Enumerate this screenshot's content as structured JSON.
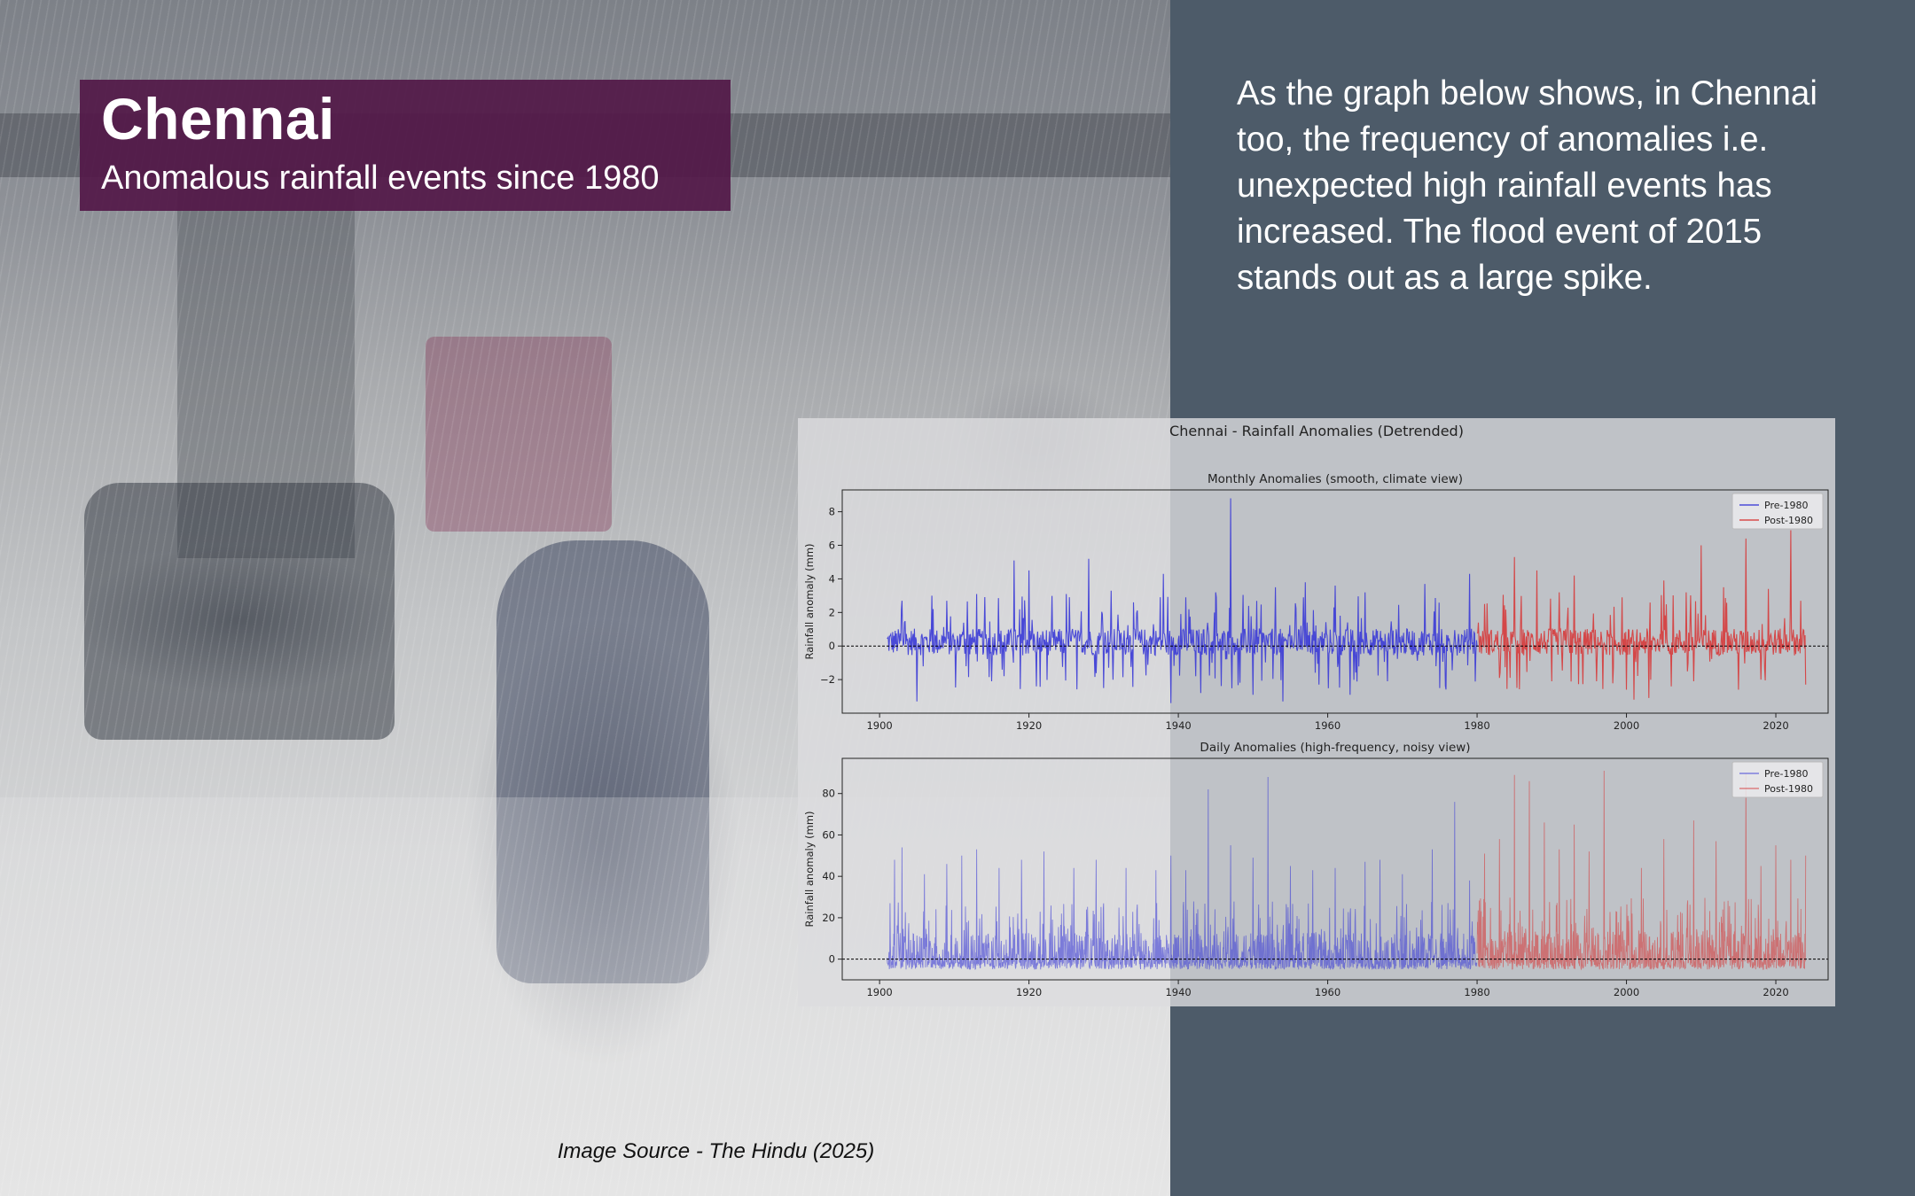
{
  "header": {
    "title": "Chennai",
    "subtitle": "Anomalous rainfall events since 1980"
  },
  "description": "As the graph below shows, in Chennai too, the frequency of anomalies i.e. unexpected high rainfall events has increased. The flood event of 2015 stands out as a large spike.",
  "source": "Image Source - The Hindu (2025)",
  "colors": {
    "background_right": "#4d5b69",
    "title_box": "#521848",
    "pre_1980": "#3a3ad6",
    "post_1980": "#d63a3a"
  },
  "chart_data": {
    "suptitle": "Chennai - Rainfall Anomalies (Detrended)",
    "panels": [
      {
        "type": "line",
        "title": "Monthly Anomalies (smooth, climate view)",
        "ylabel": "Rainfall anomaly (mm)",
        "xlim": [
          1895,
          2027
        ],
        "ylim": [
          -4,
          9.3
        ],
        "xticks": [
          1900,
          1920,
          1940,
          1960,
          1980,
          2000,
          2020
        ],
        "yticks": [
          -2,
          0,
          2,
          4,
          6,
          8
        ],
        "ytick_labels": [
          "−2",
          "0",
          "2",
          "4",
          "6",
          "8"
        ],
        "zero_line": "dashed",
        "legend_position": "top-right",
        "series": [
          {
            "name": "Pre-1980",
            "color": "#3a3ad6",
            "x_range": [
              1901,
              1980
            ],
            "peaks": [
              [
                1903,
                2.7
              ],
              [
                1905,
                2.2
              ],
              [
                1907,
                3.0
              ],
              [
                1909,
                2.7
              ],
              [
                1913,
                3.1
              ],
              [
                1915,
                4.8
              ],
              [
                1918,
                5.1
              ],
              [
                1920,
                4.5
              ],
              [
                1925,
                3.1
              ],
              [
                1928,
                5.2
              ],
              [
                1931,
                3.3
              ],
              [
                1934,
                2.6
              ],
              [
                1938,
                4.3
              ],
              [
                1941,
                2.9
              ],
              [
                1945,
                3.2
              ],
              [
                1947,
                8.8
              ],
              [
                1950,
                2.9
              ],
              [
                1953,
                3.5
              ],
              [
                1957,
                3.8
              ],
              [
                1961,
                3.6
              ],
              [
                1965,
                3.2
              ],
              [
                1968,
                2.5
              ],
              [
                1973,
                3.7
              ],
              [
                1975,
                3.9
              ],
              [
                1979,
                4.3
              ]
            ],
            "troughs": [
              [
                1905,
                -3.3
              ],
              [
                1915,
                -2.1
              ],
              [
                1921,
                -2.4
              ],
              [
                1930,
                -2.5
              ],
              [
                1939,
                -3.4
              ],
              [
                1943,
                -2.8
              ],
              [
                1950,
                -2.9
              ],
              [
                1954,
                -3.3
              ],
              [
                1963,
                -2.9
              ],
              [
                1968,
                -2.1
              ],
              [
                1975,
                -2.5
              ]
            ],
            "typical_abs": 0.8
          },
          {
            "name": "Post-1980",
            "color": "#d63a3a",
            "x_range": [
              1980,
              2024
            ],
            "peaks": [
              [
                1981,
                2.5
              ],
              [
                1985,
                5.3
              ],
              [
                1988,
                4.5
              ],
              [
                1991,
                3.2
              ],
              [
                1993,
                4.2
              ],
              [
                1996,
                5.9
              ],
              [
                2001,
                5.7
              ],
              [
                2005,
                3.9
              ],
              [
                2008,
                3.2
              ],
              [
                2010,
                6.0
              ],
              [
                2013,
                3.5
              ],
              [
                2016,
                6.4
              ],
              [
                2019,
                3.4
              ],
              [
                2022,
                6.9
              ],
              [
                2024,
                1.9
              ]
            ],
            "troughs": [
              [
                1983,
                -1.9
              ],
              [
                1990,
                -2.1
              ],
              [
                1996,
                -2.1
              ],
              [
                2000,
                -2.6
              ],
              [
                2001,
                -3.2
              ],
              [
                2003,
                -3.1
              ],
              [
                2006,
                -2.4
              ],
              [
                2009,
                -2.1
              ],
              [
                2015,
                -2.6
              ],
              [
                2018,
                -2.0
              ],
              [
                2024,
                -2.3
              ]
            ],
            "typical_abs": 0.8
          }
        ]
      },
      {
        "type": "line",
        "title": "Daily Anomalies (high-frequency, noisy view)",
        "ylabel": "Rainfall anomaly (mm)",
        "xlim": [
          1895,
          2027
        ],
        "ylim": [
          -10,
          97
        ],
        "xticks": [
          1900,
          1920,
          1940,
          1960,
          1980,
          2000,
          2020
        ],
        "yticks": [
          0,
          20,
          40,
          60,
          80
        ],
        "ytick_labels": [
          "0",
          "20",
          "40",
          "60",
          "80"
        ],
        "zero_line": "dashed",
        "legend_position": "top-right",
        "series": [
          {
            "name": "Pre-1980",
            "color": "#3a3ad6",
            "x_range": [
              1901,
              1980
            ],
            "peaks": [
              [
                1902,
                48
              ],
              [
                1903,
                54
              ],
              [
                1906,
                41
              ],
              [
                1909,
                46
              ],
              [
                1911,
                50
              ],
              [
                1913,
                53
              ],
              [
                1916,
                44
              ],
              [
                1919,
                48
              ],
              [
                1922,
                52
              ],
              [
                1926,
                44
              ],
              [
                1929,
                48
              ],
              [
                1933,
                44
              ],
              [
                1937,
                43
              ],
              [
                1939,
                50
              ],
              [
                1941,
                43
              ],
              [
                1944,
                82
              ],
              [
                1947,
                55
              ],
              [
                1950,
                49
              ],
              [
                1952,
                88
              ],
              [
                1955,
                45
              ],
              [
                1958,
                43
              ],
              [
                1961,
                44
              ],
              [
                1965,
                47
              ],
              [
                1967,
                48
              ],
              [
                1970,
                41
              ],
              [
                1974,
                53
              ],
              [
                1977,
                76
              ],
              [
                1979,
                38
              ]
            ],
            "typical_max": 28,
            "min": -5
          },
          {
            "name": "Post-1980",
            "color": "#d63a3a",
            "x_range": [
              1980,
              2024
            ],
            "peaks": [
              [
                1981,
                51
              ],
              [
                1983,
                58
              ],
              [
                1985,
                89
              ],
              [
                1987,
                86
              ],
              [
                1989,
                66
              ],
              [
                1991,
                53
              ],
              [
                1993,
                65
              ],
              [
                1995,
                52
              ],
              [
                1997,
                91
              ],
              [
                2002,
                44
              ],
              [
                2005,
                58
              ],
              [
                2009,
                67
              ],
              [
                2012,
                57
              ],
              [
                2016,
                90
              ],
              [
                2018,
                45
              ],
              [
                2020,
                55
              ],
              [
                2022,
                48
              ],
              [
                2024,
                50
              ]
            ],
            "typical_max": 30,
            "min": -5
          }
        ]
      }
    ],
    "legend": [
      "Pre-1980",
      "Post-1980"
    ]
  }
}
